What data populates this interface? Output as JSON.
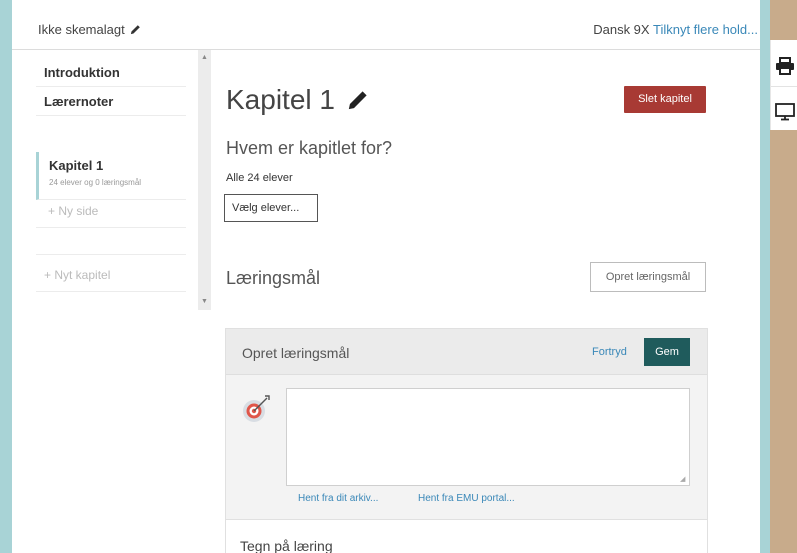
{
  "header": {
    "schedule_label": "Ikke skemalagt",
    "team_name": "Dansk 9X",
    "team_link": "Tilknyt flere hold..."
  },
  "sidebar": {
    "items": [
      {
        "label": "Introduktion"
      },
      {
        "label": "Lærernoter"
      }
    ],
    "chapter": {
      "title": "Kapitel 1",
      "subtitle": "24 elever og 0 læringsmål"
    },
    "new_page": "+ Ny side",
    "new_chapter": "+ Nyt kapitel"
  },
  "main": {
    "chapter_title": "Kapitel 1",
    "delete_button": "Slet kapitel",
    "who_title": "Hvem er kapitlet for?",
    "who_subtitle": "Alle 24 elever",
    "choose_students_button": "Vælg elever...",
    "goals_title": "Læringsmål",
    "create_goal_button": "Opret læringsmål"
  },
  "goal_panel": {
    "title": "Opret læringsmål",
    "undo_link": "Fortryd",
    "save_button": "Gem",
    "textarea_value": "",
    "archive_link": "Hent fra dit arkiv...",
    "emu_link": "Hent fra EMU portal...",
    "bottom_title": "Tegn på læring"
  },
  "icons": {
    "schedule_edit": "pencil-icon",
    "title_edit": "pencil-icon",
    "goal": "target-icon",
    "print": "printer-icon",
    "screen": "monitor-icon"
  },
  "colors": {
    "accent_teal": "#a8d3d6",
    "side_tan": "#c8ab8b",
    "delete_red": "#a83a34",
    "save_dark_teal": "#1f5b5c",
    "link_blue": "#3a88b8"
  }
}
